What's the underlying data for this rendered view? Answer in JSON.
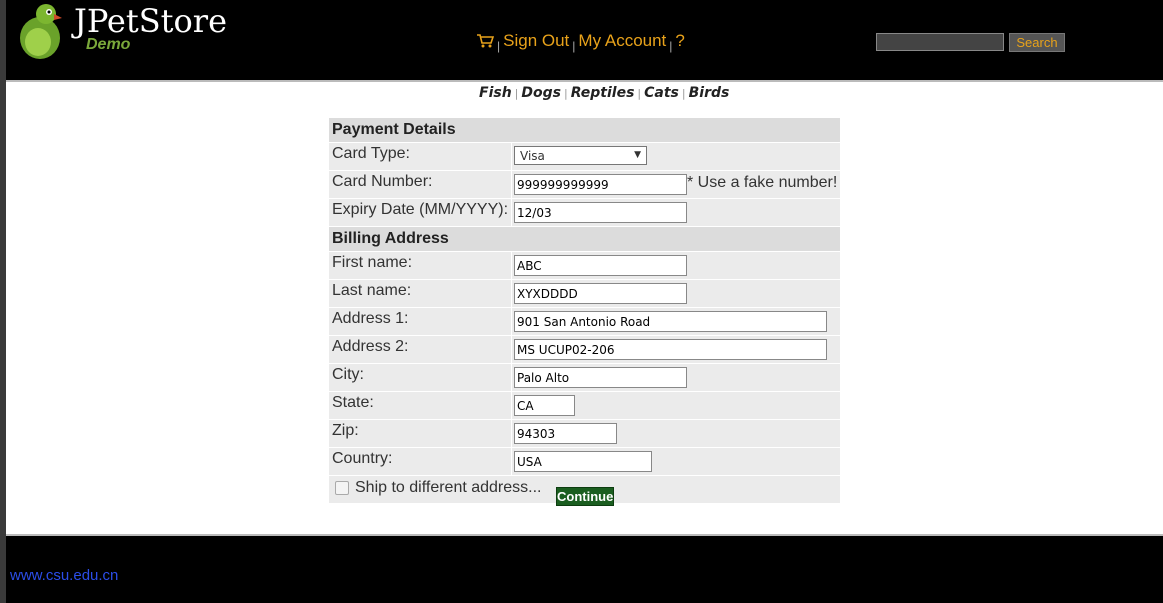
{
  "header": {
    "brand": "JPetStore",
    "brand_sub": "Demo",
    "cart_icon": "cart-icon",
    "sign_out": "Sign Out",
    "my_account": "My Account",
    "help": "?",
    "search_placeholder": "",
    "search_button": "Search"
  },
  "quicklinks": [
    "Fish",
    "Dogs",
    "Reptiles",
    "Cats",
    "Birds"
  ],
  "form": {
    "payment_title": "Payment Details",
    "card_type_label": "Card Type:",
    "card_type_value": "Visa",
    "card_number_label": "Card Number:",
    "card_number_value": "999999999999",
    "card_number_hint": "* Use a fake number!",
    "expiry_label": "Expiry Date (MM/YYYY):",
    "expiry_value": "12/03",
    "billing_title": "Billing Address",
    "first_name_label": "First name:",
    "first_name_value": "ABC",
    "last_name_label": "Last name:",
    "last_name_value": "XYXDDDD",
    "address1_label": "Address 1:",
    "address1_value": "901 San Antonio Road",
    "address2_label": "Address 2:",
    "address2_value": "MS UCUP02-206",
    "city_label": "City:",
    "city_value": "Palo Alto",
    "state_label": "State:",
    "state_value": "CA",
    "zip_label": "Zip:",
    "zip_value": "94303",
    "country_label": "Country:",
    "country_value": "USA",
    "ship_label": "Ship to different address...",
    "continue_label": "Continue"
  },
  "footer": {
    "link": "www.csu.edu.cn"
  },
  "colors": {
    "accent": "#e8a21a",
    "continue": "#1b5e20",
    "row_bg": "#ebebeb"
  }
}
